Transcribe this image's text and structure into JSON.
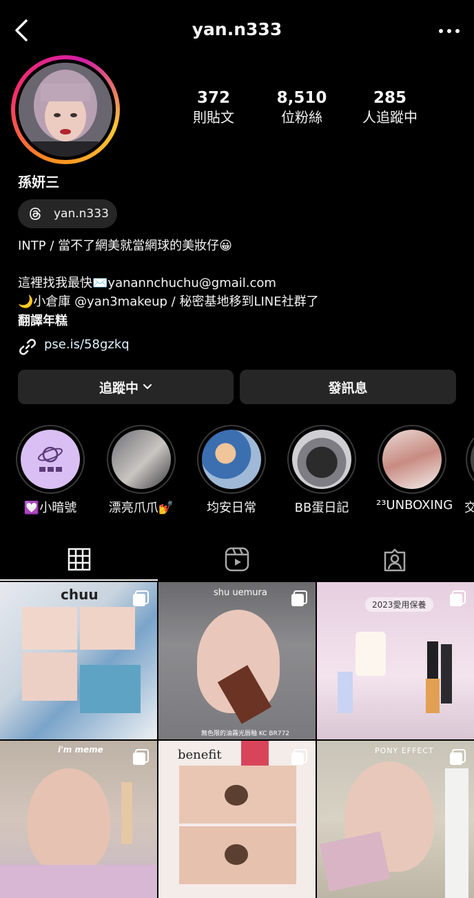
{
  "header": {
    "username": "yan.n333"
  },
  "stats": [
    {
      "value": "372",
      "label": "則貼文"
    },
    {
      "value": "8,510",
      "label": "位粉絲"
    },
    {
      "value": "285",
      "label": "人追蹤中"
    }
  ],
  "profile": {
    "display_name": "孫妍三",
    "threads_handle": "yan.n333",
    "bio_line1": "INTP / 當不了網美就當網球的美妝仔😀",
    "bio_line2": "這裡找我最快✉️yanannchuchu@gmail.com",
    "bio_line3": "🌙小倉庫 @yan3makeup / 秘密基地移到LINE社群了",
    "translate": "翻譯年糕",
    "link": "pse.is/58gzkq"
  },
  "buttons": {
    "following": "追蹤中",
    "message": "發訊息"
  },
  "highlights": [
    {
      "label": "💟小暗號"
    },
    {
      "label": "漂亮爪爪💅"
    },
    {
      "label": "均安日常"
    },
    {
      "label": "BB蛋日記"
    },
    {
      "label": "²³UNBOXING"
    },
    {
      "label": "交"
    }
  ],
  "posts": [
    {
      "brand": "chuu"
    },
    {
      "brand": "shu uemura",
      "caption": "無色限的油霧光唇釉 KC BR772"
    },
    {
      "brand": "2023愛用保養"
    },
    {
      "brand": "i'm meme"
    },
    {
      "brand": "benefit"
    },
    {
      "brand": "PONY EFFECT"
    }
  ],
  "colors": {
    "background": "#000000",
    "button": "#262626",
    "link": "#e0f1ff"
  }
}
